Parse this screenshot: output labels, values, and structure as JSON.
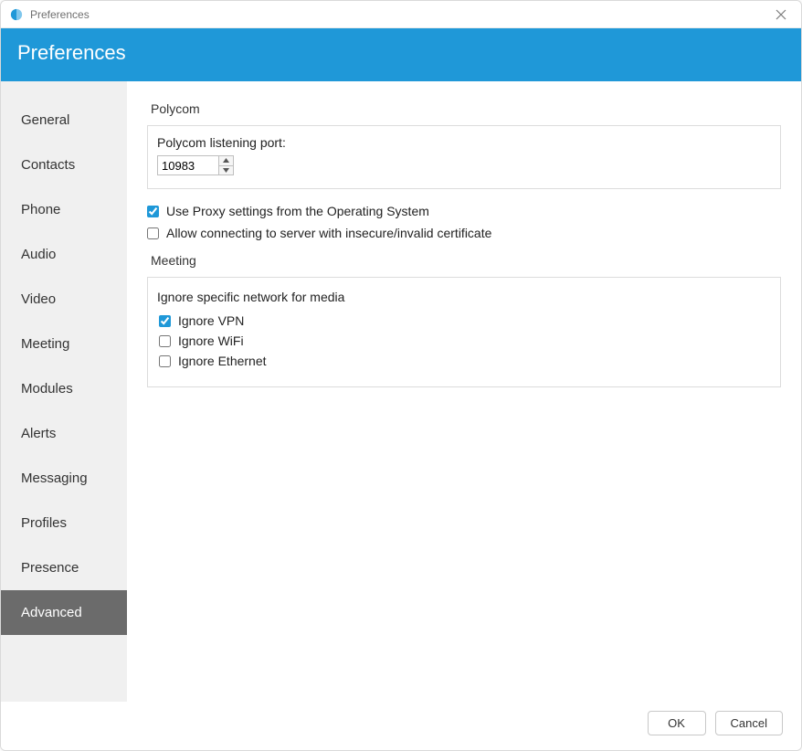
{
  "window": {
    "title": "Preferences"
  },
  "header": {
    "title": "Preferences"
  },
  "sidebar": {
    "items": [
      {
        "key": "general",
        "label": "General",
        "selected": false
      },
      {
        "key": "contacts",
        "label": "Contacts",
        "selected": false
      },
      {
        "key": "phone",
        "label": "Phone",
        "selected": false
      },
      {
        "key": "audio",
        "label": "Audio",
        "selected": false
      },
      {
        "key": "video",
        "label": "Video",
        "selected": false
      },
      {
        "key": "meeting",
        "label": "Meeting",
        "selected": false
      },
      {
        "key": "modules",
        "label": "Modules",
        "selected": false
      },
      {
        "key": "alerts",
        "label": "Alerts",
        "selected": false
      },
      {
        "key": "messaging",
        "label": "Messaging",
        "selected": false
      },
      {
        "key": "profiles",
        "label": "Profiles",
        "selected": false
      },
      {
        "key": "presence",
        "label": "Presence",
        "selected": false
      },
      {
        "key": "advanced",
        "label": "Advanced",
        "selected": true
      }
    ]
  },
  "content": {
    "polycom": {
      "section_title": "Polycom",
      "listening_port_label": "Polycom listening port:",
      "listening_port_value": "10983"
    },
    "use_proxy": {
      "label": "Use Proxy settings from the Operating System",
      "checked": true
    },
    "allow_insecure": {
      "label": "Allow connecting to server with insecure/invalid certificate",
      "checked": false
    },
    "meeting": {
      "section_title": "Meeting",
      "ignore_network_title": "Ignore specific network for media",
      "ignore_vpn": {
        "label": "Ignore VPN",
        "checked": true
      },
      "ignore_wifi": {
        "label": "Ignore WiFi",
        "checked": false
      },
      "ignore_ethernet": {
        "label": "Ignore Ethernet",
        "checked": false
      }
    }
  },
  "footer": {
    "ok_label": "OK",
    "cancel_label": "Cancel"
  },
  "colors": {
    "accent": "#1f98d8",
    "sidebar_bg": "#f0f0f0",
    "selected_bg": "#6b6b6b"
  }
}
